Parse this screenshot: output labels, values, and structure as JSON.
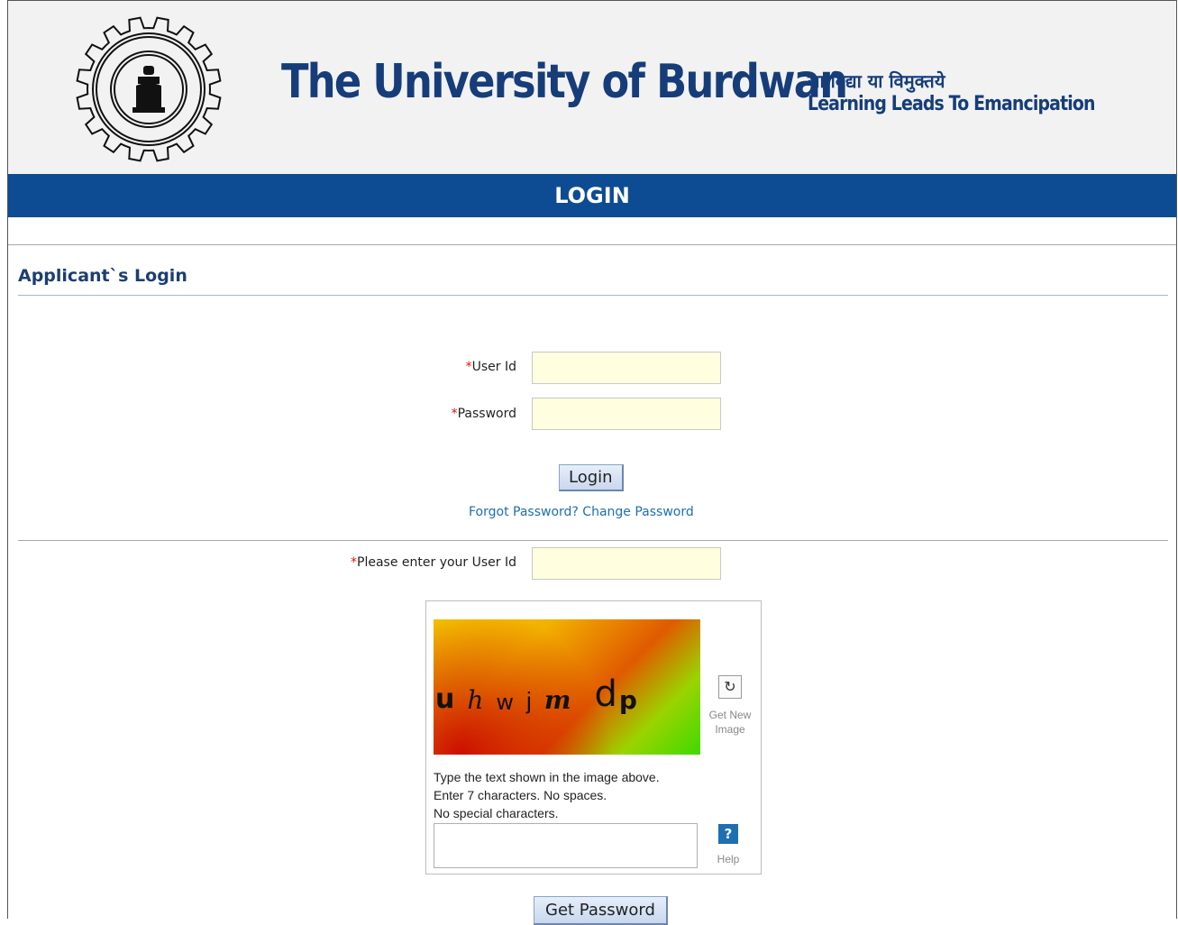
{
  "header": {
    "title": "The University of Burdwan",
    "motto_hindi": "सा विद्या या विमुक्तये",
    "motto_english": "Learning Leads To Emancipation",
    "logo_icon": "university-seal-icon"
  },
  "banner": {
    "label": "LOGIN"
  },
  "section": {
    "title": "Applicant`s Login"
  },
  "login_form": {
    "required_mark": "*",
    "user_id_label": "User Id",
    "password_label": "Password",
    "user_id_value": "",
    "password_value": "",
    "login_button": "Login",
    "forgot_password_link": "Forgot Password?",
    "change_password_link": "Change Password"
  },
  "recovery_form": {
    "required_mark": "*",
    "user_id_label": "Please enter your User Id",
    "user_id_value": "",
    "captcha": {
      "characters": [
        "u",
        "h",
        "w",
        "j",
        "m",
        "d",
        "p"
      ],
      "refresh_icon": "refresh-icon",
      "refresh_label_1": "Get New",
      "refresh_label_2": "Image",
      "instruction_1": "Type the text shown in the image above.",
      "instruction_2": "Enter 7 characters. No spaces.",
      "instruction_3": "No special characters.",
      "help_icon": "help-icon",
      "help_symbol": "?",
      "help_label": "Help",
      "input_value": ""
    },
    "get_password_button": "Get Password"
  },
  "colors": {
    "brand_blue": "#163d7a",
    "banner_blue": "#0d4c92",
    "link_blue": "#1d6fb0",
    "required_red": "#dd1111",
    "input_bg": "#ffffe0"
  }
}
